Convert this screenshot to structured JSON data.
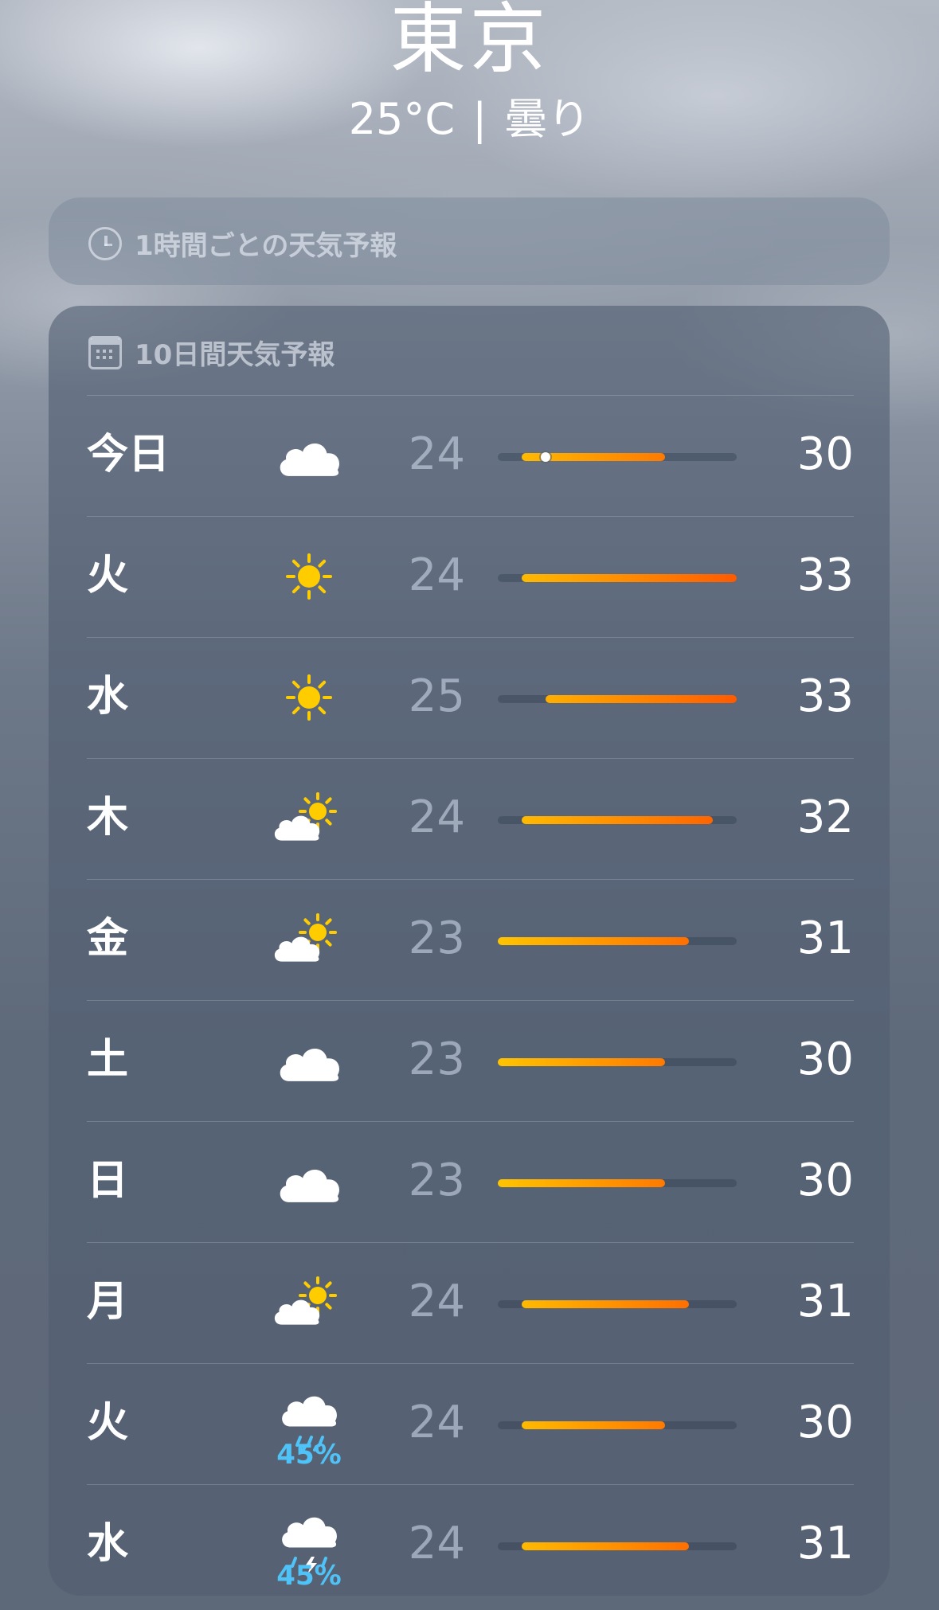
{
  "location": {
    "city": "東京",
    "temperature": "25°C",
    "separator": "|",
    "condition": "曇り"
  },
  "hourly_card": {
    "title": "1時間ごとの天気予報",
    "icon": "clock-icon"
  },
  "daily_card": {
    "title": "10日間天気予報",
    "icon": "calendar-icon",
    "range_min": 23,
    "range_max": 33,
    "days": [
      {
        "day": "今日",
        "icon": "cloud",
        "precip": "",
        "low": "24",
        "high": "30",
        "current": 25
      },
      {
        "day": "火",
        "icon": "sun",
        "precip": "",
        "low": "24",
        "high": "33"
      },
      {
        "day": "水",
        "icon": "sun",
        "precip": "",
        "low": "25",
        "high": "33"
      },
      {
        "day": "木",
        "icon": "sun-behind-cloud",
        "precip": "",
        "low": "24",
        "high": "32"
      },
      {
        "day": "金",
        "icon": "sun-behind-cloud",
        "precip": "",
        "low": "23",
        "high": "31"
      },
      {
        "day": "土",
        "icon": "cloud",
        "precip": "",
        "low": "23",
        "high": "30"
      },
      {
        "day": "日",
        "icon": "cloud",
        "precip": "",
        "low": "23",
        "high": "30"
      },
      {
        "day": "月",
        "icon": "sun-behind-cloud",
        "precip": "",
        "low": "24",
        "high": "31"
      },
      {
        "day": "火",
        "icon": "cloud-rain",
        "precip": "45%",
        "low": "24",
        "high": "30"
      },
      {
        "day": "水",
        "icon": "cloud-thunderstorm",
        "precip": "45%",
        "low": "24",
        "high": "31"
      }
    ]
  },
  "colors": {
    "bar_start": "#ffcc00",
    "bar_end": "#ff6a00",
    "precip": "#4fc3f7",
    "sun": "#ffcc00"
  }
}
